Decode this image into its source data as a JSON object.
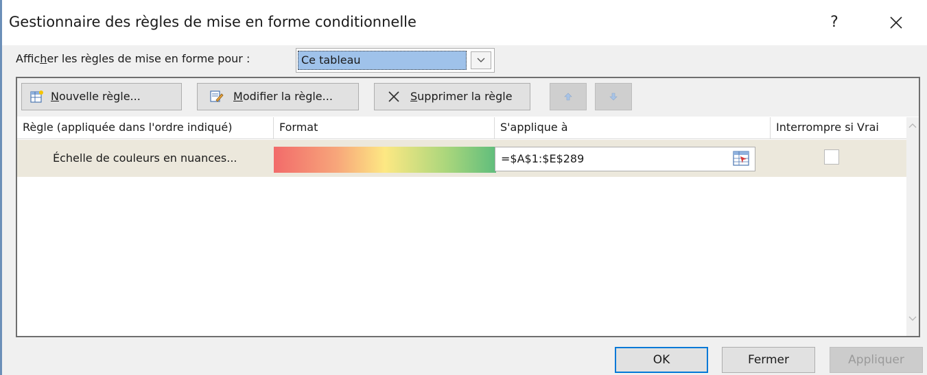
{
  "dialog": {
    "title": "Gestionnaire des règles de mise en forme conditionnelle",
    "help_label": "?",
    "accent_color": "#0078d7"
  },
  "filter": {
    "label_before": "Affic",
    "label_underlined": "h",
    "label_after": "er les règles de mise en forme pour :",
    "selected_value": "Ce tableau"
  },
  "toolbar": {
    "new_rule": {
      "underlined": "N",
      "rest": "ouvelle règle..."
    },
    "edit_rule": {
      "underlined": "M",
      "rest": "odifier la règle..."
    },
    "delete_rule": {
      "underlined": "S",
      "rest": "upprimer la règle"
    },
    "icons": [
      "new-rule-icon",
      "edit-rule-icon",
      "delete-icon",
      "move-up-icon",
      "move-down-icon"
    ]
  },
  "table": {
    "columns": [
      "Règle (appliquée dans l'ordre indiqué)",
      "Format",
      "S'applique à",
      "Interrompre si Vrai"
    ],
    "rows": [
      {
        "rule": "Échelle de couleurs en nuances...",
        "format_colors": [
          "#f26b6a",
          "#fde883",
          "#5fbd7c"
        ],
        "applies_to": "=$A$1:$E$289",
        "stop_if_true": false
      }
    ]
  },
  "buttons": {
    "ok": "OK",
    "close": "Fermer",
    "apply": "Appliquer",
    "apply_enabled": false
  }
}
